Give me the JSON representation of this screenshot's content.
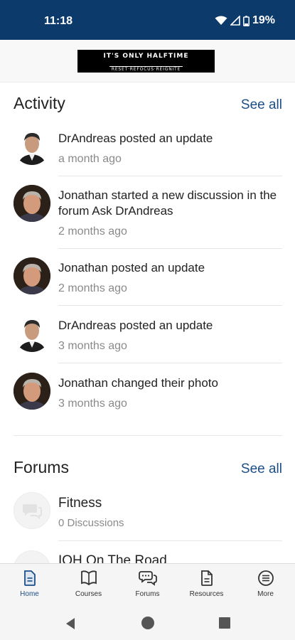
{
  "status_bar": {
    "time": "11:18",
    "battery": "19%"
  },
  "header": {
    "logo_line1": "IT'S ONLY HALFTIME",
    "logo_line2": "RESET·REFOCUS·REIGNITE"
  },
  "activity": {
    "title": "Activity",
    "see_all": "See all",
    "items": [
      {
        "title": "DrAndreas posted an update",
        "time": "a month ago",
        "avatar": "andreas"
      },
      {
        "title": "Jonathan started a new discussion in the forum Ask DrAndreas",
        "time": "2 months ago",
        "avatar": "jonathan"
      },
      {
        "title": "Jonathan posted an update",
        "time": "2 months ago",
        "avatar": "jonathan"
      },
      {
        "title": "DrAndreas posted an update",
        "time": "3 months ago",
        "avatar": "andreas"
      },
      {
        "title": "Jonathan changed their photo",
        "time": "3 months ago",
        "avatar": "jonathan"
      }
    ]
  },
  "forums": {
    "title": "Forums",
    "see_all": "See all",
    "items": [
      {
        "title": "Fitness",
        "count": "0 Discussions"
      },
      {
        "title": "IOH On The Road"
      }
    ]
  },
  "tabs": [
    {
      "label": "Home",
      "icon": "document-icon"
    },
    {
      "label": "Courses",
      "icon": "book-icon"
    },
    {
      "label": "Forums",
      "icon": "chat-bubbles-icon"
    },
    {
      "label": "Resources",
      "icon": "file-icon"
    },
    {
      "label": "More",
      "icon": "menu-circle-icon"
    }
  ],
  "colors": {
    "status_bar": "#0c3a6b",
    "accent": "#1c4e86",
    "muted": "#8a8a8a"
  }
}
